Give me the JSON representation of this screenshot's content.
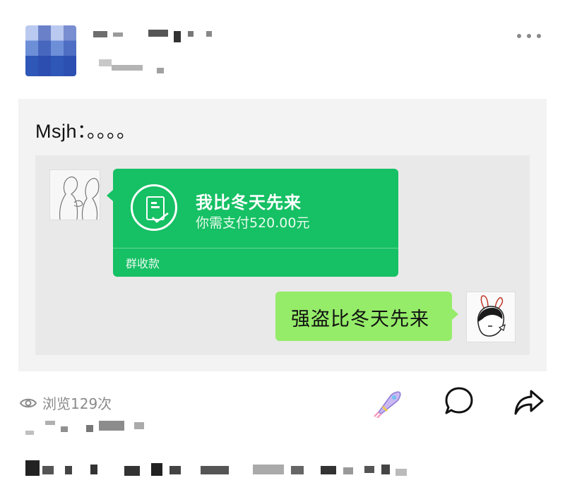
{
  "post": {
    "card_text": "Msjh：。。。。",
    "payment": {
      "title": "我比冬天先来",
      "subtitle": "你需支付520.00元",
      "footer": "群收款"
    },
    "reply": "强盗比冬天先来"
  },
  "footer": {
    "views": "浏览129次"
  },
  "colors": {
    "pay_green": "#16c064",
    "bubble_green": "#95ec69",
    "card_bg": "#f3f3f3",
    "muted": "#8a8a8a"
  },
  "icons": [
    "eye-icon",
    "more-icon",
    "rocket-sticker-icon",
    "comment-icon",
    "share-icon",
    "bill-icon"
  ]
}
